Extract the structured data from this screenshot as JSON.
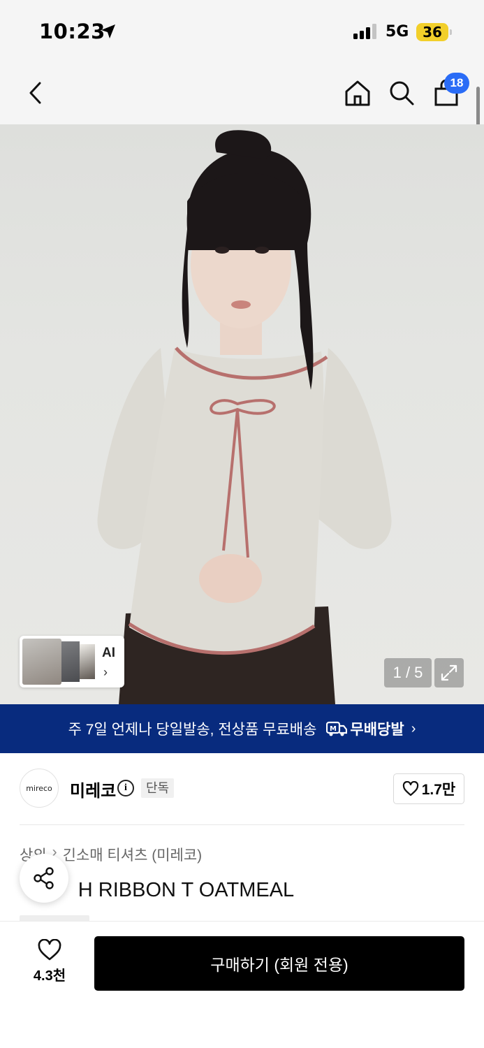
{
  "status_bar": {
    "time": "10:23",
    "network": "5G",
    "battery": "36"
  },
  "nav": {
    "cart_count": "18",
    "icons": [
      "back-icon",
      "home-icon",
      "search-icon",
      "cart-icon"
    ]
  },
  "gallery": {
    "ai_label": "AI",
    "ai_chevron": "›",
    "page_counter": "1 / 5"
  },
  "promo": {
    "text": "주 7일 언제나 당일발송, 전상품 무료배송",
    "logo_text": "무배당발",
    "chevron": "›"
  },
  "brand": {
    "logo_text": "mireco",
    "name": "미레코",
    "info_symbol": "i",
    "tag": "단독",
    "like_count": "1.7만"
  },
  "breadcrumb": [
    "상의",
    "긴소매 티셔츠 (미레코)"
  ],
  "breadcrumb_sep": "›",
  "product": {
    "title": "STITCH RIBBON T OATMEAL"
  },
  "bottom": {
    "wish_count": "4.3천",
    "buy_label": "구매하기 (회원 전용)"
  },
  "colors": {
    "accent_blue": "#2a6cf6",
    "banner_navy": "#082b7e",
    "battery_yellow": "#f2cf2a"
  }
}
